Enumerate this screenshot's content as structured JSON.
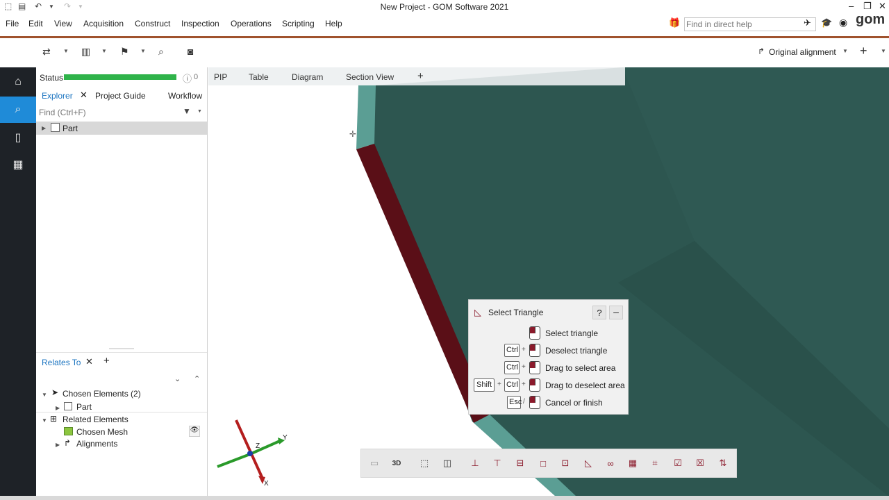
{
  "window": {
    "title": "New Project - GOM Software 2021"
  },
  "menu": {
    "items": [
      "File",
      "Edit",
      "View",
      "Acquisition",
      "Construct",
      "Inspection",
      "Operations",
      "Scripting",
      "Help"
    ]
  },
  "help_search": {
    "placeholder": "Find in direct help"
  },
  "brand": {
    "logo": "gom"
  },
  "toolbar": {
    "alignment_label": "Original alignment",
    "add_label": "+"
  },
  "explorer": {
    "status_label": "Status",
    "status_count": "0",
    "tabs": [
      "Explorer",
      "Project Guide",
      "Workflow"
    ],
    "find_placeholder": "Find (Ctrl+F)",
    "tree_root": "Part"
  },
  "relates": {
    "tab_label": "Relates To",
    "chosen_elements": "Chosen Elements (2)",
    "chosen_child": "Part",
    "related_elements": "Related Elements",
    "chosen_mesh": "Chosen Mesh",
    "alignments": "Alignments"
  },
  "viewport": {
    "tabs": [
      "PIP",
      "Table",
      "Diagram",
      "Section View"
    ],
    "add_tab": "+",
    "axes": {
      "x": "X",
      "y": "Y",
      "z": "Z"
    }
  },
  "dialog": {
    "title": "Select Triangle",
    "help": "?",
    "rows": [
      {
        "text": "Select triangle"
      },
      {
        "key1": "Ctrl",
        "plus1": "+",
        "text": "Deselect triangle"
      },
      {
        "key1": "Ctrl",
        "plus1": "+",
        "text": "Drag to select area"
      },
      {
        "key0": "Shift",
        "plus0": "+",
        "key1": "Ctrl",
        "plus1": "+",
        "text": "Drag to deselect area"
      },
      {
        "key1": "Esc",
        "plus1": "/",
        "text": "Cancel or finish"
      }
    ]
  },
  "colors": {
    "accent": "#1f8bd8",
    "status_green": "#2fb34a",
    "mesh_green": "#2d5650",
    "selected_red": "#5a0f17",
    "edge_teal": "#5b9e94"
  }
}
